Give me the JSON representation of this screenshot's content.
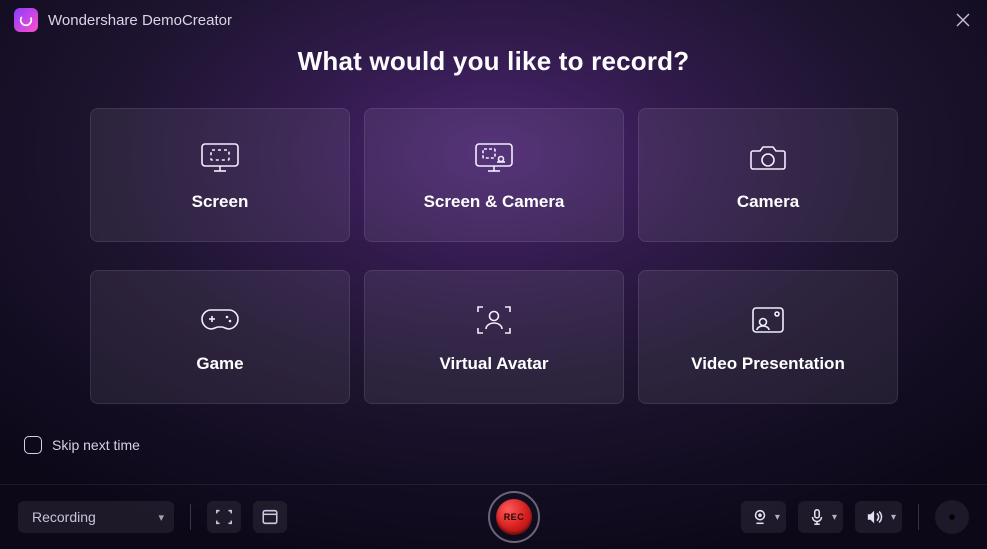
{
  "app_title": "Wondershare DemoCreator",
  "heading": "What would you like to record?",
  "options": [
    {
      "label": "Screen",
      "icon": "screen"
    },
    {
      "label": "Screen & Camera",
      "icon": "screen-camera"
    },
    {
      "label": "Camera",
      "icon": "camera"
    },
    {
      "label": "Game",
      "icon": "game"
    },
    {
      "label": "Virtual Avatar",
      "icon": "avatar"
    },
    {
      "label": "Video Presentation",
      "icon": "presentation"
    }
  ],
  "skip_label": "Skip next time",
  "skip_checked": false,
  "footer": {
    "mode_label": "Recording",
    "record_label": "REC"
  }
}
